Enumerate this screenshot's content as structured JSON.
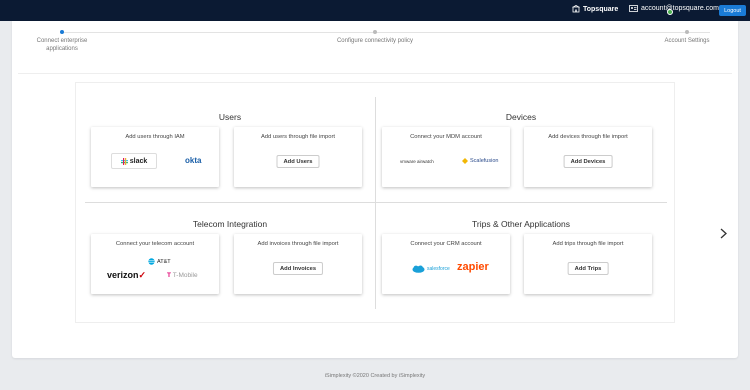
{
  "header": {
    "org_name": "Topsquare",
    "account_email": "account@topsquare.com",
    "logout_label": "Logout"
  },
  "stepper": {
    "steps": [
      {
        "label": "Connect enterprise applications",
        "active": true
      },
      {
        "label": "Configure connectivity policy",
        "active": false
      },
      {
        "label": "Account Settings",
        "active": false
      }
    ]
  },
  "sections": {
    "users": {
      "title": "Users",
      "card1": {
        "title": "Add users through IAM",
        "logos": [
          "slack",
          "okta"
        ]
      },
      "card2": {
        "title": "Add users through file import",
        "button": "Add Users"
      }
    },
    "devices": {
      "title": "Devices",
      "card1": {
        "title": "Connect your MDM account",
        "logos": [
          "vmware airwatch",
          "Scalefusion"
        ]
      },
      "card2": {
        "title": "Add devices through file import",
        "button": "Add Devices"
      }
    },
    "telecom": {
      "title": "Telecom Integration",
      "card1": {
        "title": "Connect your telecom account",
        "logos": [
          "AT&T",
          "verizon",
          "T-Mobile"
        ]
      },
      "card2": {
        "title": "Add invoices through file import",
        "button": "Add Invoices"
      }
    },
    "trips": {
      "title": "Trips & Other Applications",
      "card1": {
        "title": "Connect your CRM account",
        "logos": [
          "salesforce",
          "zapier"
        ]
      },
      "card2": {
        "title": "Add trips through file import",
        "button": "Add Trips"
      }
    }
  },
  "footer": {
    "text": "iSimplexity ©2020 Created by iSimplexity"
  },
  "colors": {
    "topbar": "#0b1a33",
    "accent": "#1a7bd6"
  }
}
